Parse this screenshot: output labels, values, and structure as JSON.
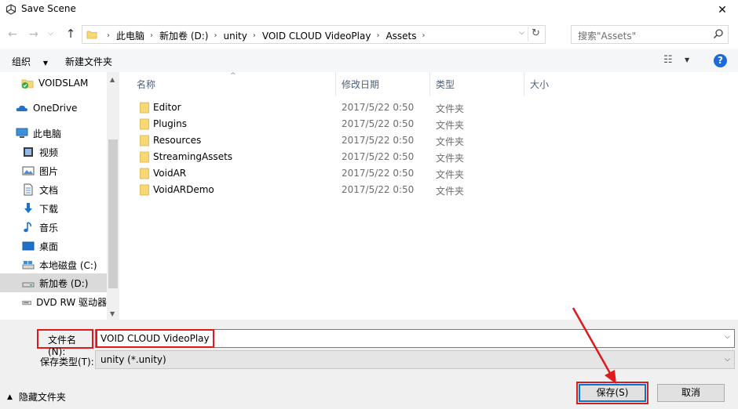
{
  "window": {
    "title": "Save Scene",
    "close_glyph": "✕"
  },
  "nav": {
    "back_glyph": "←",
    "forward_glyph": "→",
    "recent_glyph": "⌵",
    "up_glyph": "↑",
    "breadcrumbs": [
      "此电脑",
      "新加卷 (D:)",
      "unity",
      "VOID CLOUD VideoPlay",
      "Assets"
    ],
    "crumb_separator": "›",
    "dropdown_glyph": "⌵",
    "refresh_glyph": "↻",
    "search_placeholder": "搜索\"Assets\""
  },
  "toolbar": {
    "organize_label": "组织",
    "organize_caret": "▼",
    "new_folder_label": "新建文件夹",
    "views_glyph": "☷",
    "views_caret": "▼",
    "help_glyph": "?"
  },
  "sidebar": {
    "items": [
      {
        "label": "VOIDSLAM",
        "icon": "folder-check-icon"
      },
      {
        "label": "OneDrive",
        "icon": "cloud-icon"
      },
      {
        "label": "此电脑",
        "icon": "computer-icon"
      },
      {
        "label": "视频",
        "icon": "video-icon"
      },
      {
        "label": "图片",
        "icon": "pictures-icon"
      },
      {
        "label": "文档",
        "icon": "documents-icon"
      },
      {
        "label": "下载",
        "icon": "download-icon"
      },
      {
        "label": "音乐",
        "icon": "music-icon"
      },
      {
        "label": "桌面",
        "icon": "desktop-icon"
      },
      {
        "label": "本地磁盘 (C:)",
        "icon": "drive-icon"
      },
      {
        "label": "新加卷 (D:)",
        "icon": "drive-icon",
        "selected": true
      },
      {
        "label": "DVD RW 驱动器",
        "icon": "dvd-icon"
      }
    ],
    "scroll_up_glyph": "▲",
    "scroll_down_glyph": "▼"
  },
  "filelist": {
    "columns": [
      "名称",
      "修改日期",
      "类型",
      "大小"
    ],
    "sort_glyph": "^",
    "rows": [
      {
        "name": "Editor",
        "date": "2017/5/22 0:50",
        "type": "文件夹"
      },
      {
        "name": "Plugins",
        "date": "2017/5/22 0:50",
        "type": "文件夹"
      },
      {
        "name": "Resources",
        "date": "2017/5/22 0:50",
        "type": "文件夹"
      },
      {
        "name": "StreamingAssets",
        "date": "2017/5/22 0:50",
        "type": "文件夹"
      },
      {
        "name": "VoidAR",
        "date": "2017/5/22 0:50",
        "type": "文件夹"
      },
      {
        "name": "VoidARDemo",
        "date": "2017/5/22 0:50",
        "type": "文件夹"
      }
    ]
  },
  "form": {
    "filename_label": "文件名(N):",
    "filename_value": "VOID CLOUD VideoPlay",
    "filetype_label": "保存类型(T):",
    "filetype_value": "unity (*.unity)",
    "dropdown_glyph": "⌵"
  },
  "footer": {
    "hide_folders_caret": "▲",
    "hide_folders_label": "隐藏文件夹",
    "save_label": "保存(S)",
    "cancel_label": "取消"
  },
  "colors": {
    "accent": "#0078d7",
    "annotation": "#e01a1a",
    "folder": "#f8d775"
  }
}
